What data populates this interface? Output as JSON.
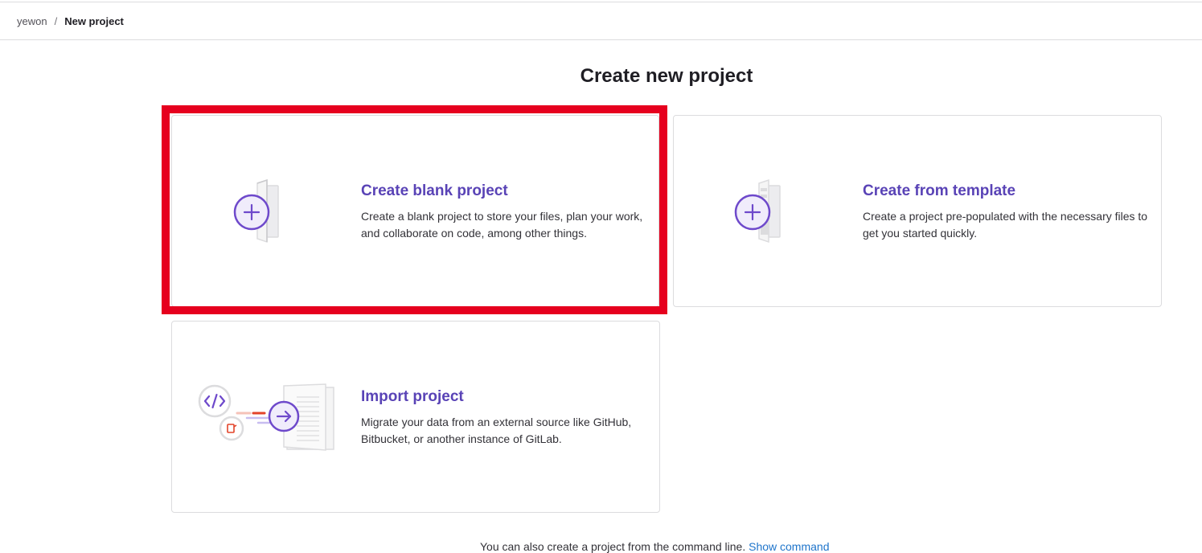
{
  "breadcrumb": {
    "parent": "yewon",
    "separator": "/",
    "current": "New project"
  },
  "page": {
    "title": "Create new project"
  },
  "cards": {
    "blank": {
      "title": "Create blank project",
      "description": "Create a blank project to store your files, plan your work, and collaborate on code, among other things.",
      "icon": "plus-icon"
    },
    "template": {
      "title": "Create from template",
      "description": "Create a project pre-populated with the necessary files to get you started quickly.",
      "icon": "plus-icon"
    },
    "import": {
      "title": "Import project",
      "description": "Migrate your data from an external source like GitHub, Bitbucket, or another instance of GitLab.",
      "icon": "arrow-right-icon"
    }
  },
  "footer": {
    "text": "You can also create a project from the command line.",
    "link": "Show command"
  },
  "colors": {
    "accent": "#5943b6",
    "highlight": "#e6001e",
    "link": "#1f75cb"
  }
}
